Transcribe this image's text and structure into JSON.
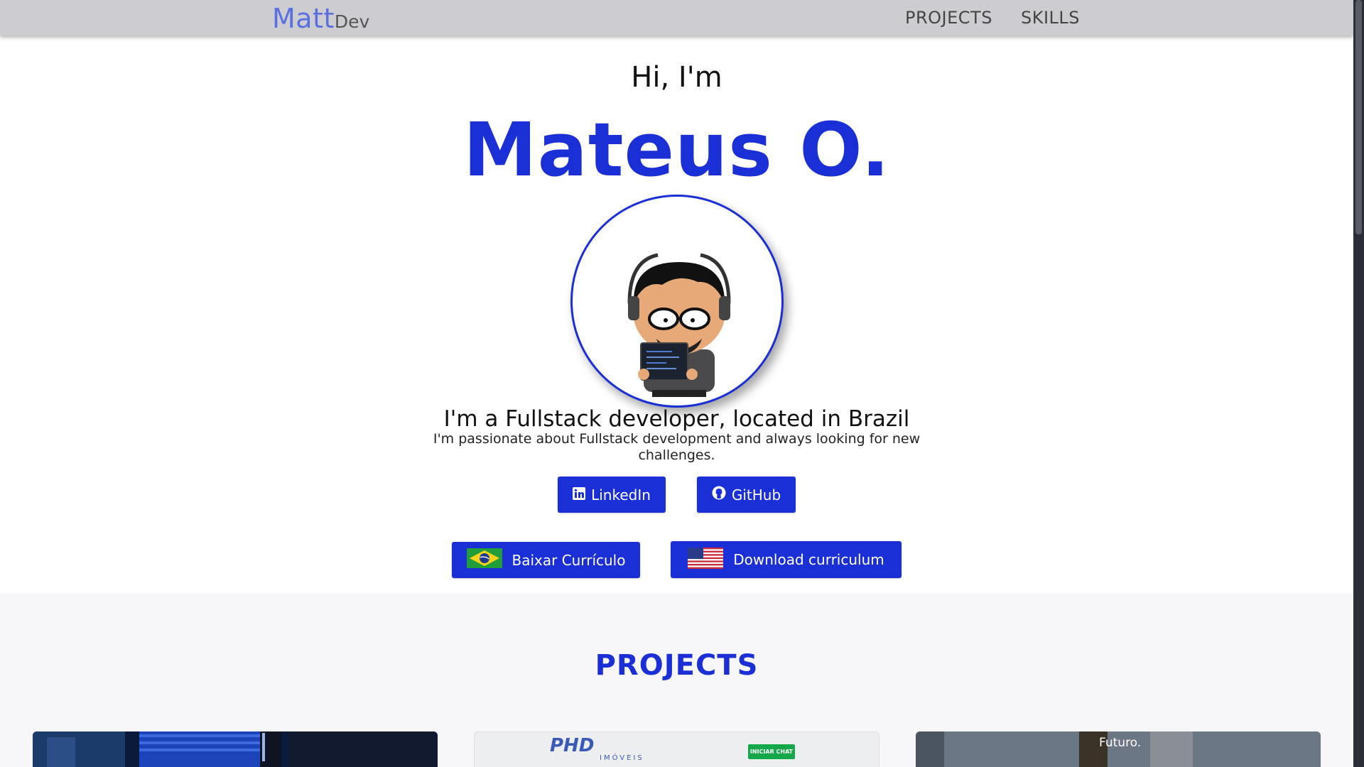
{
  "navbar": {
    "brand_main": "Matt",
    "brand_sub": "Dev",
    "links": [
      "PROJECTS",
      "SKILLS"
    ]
  },
  "hero": {
    "greeting": "Hi, I'm",
    "name": "Mateus O.",
    "headline": "I'm a Fullstack developer, located in Brazil",
    "subtext": "I'm passionate about Fullstack development and always looking for new challenges.",
    "buttons": {
      "linkedin": "LinkedIn",
      "github": "GitHub",
      "resume_br": "Baixar Currículo",
      "resume_us": "Download curriculum"
    }
  },
  "projects": {
    "title": "PROJECTS",
    "cards": [
      {
        "caption": ""
      },
      {
        "logo": "PHD",
        "logo_sub": "IMÓVEIS",
        "chat_label": "INICIAR CHAT"
      },
      {
        "caption": "Futuro."
      }
    ]
  },
  "colors": {
    "accent": "#1a2fd6",
    "navbar_bg": "#cdcdd1",
    "brand": "#5a6fe0",
    "section_bg": "#f7f6f8"
  },
  "icons": [
    "linkedin-icon",
    "github-icon",
    "brazil-flag-icon",
    "usa-flag-icon"
  ]
}
